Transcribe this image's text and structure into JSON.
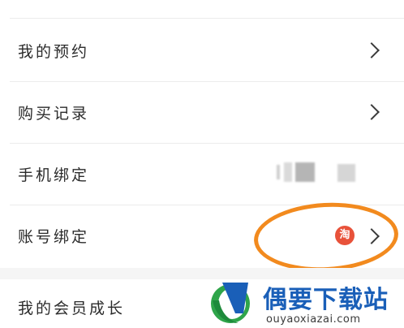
{
  "menu": {
    "items": [
      {
        "label": "我的预约",
        "has_arrow": true
      },
      {
        "label": "购买记录",
        "has_arrow": true
      },
      {
        "label": "手机绑定",
        "has_arrow": false,
        "value": "(blurred)"
      },
      {
        "label": "账号绑定",
        "has_arrow": true,
        "badge_text": "淘",
        "badge_color": "#e8523a"
      }
    ]
  },
  "section2": {
    "label": "我的会员成长"
  },
  "highlight": {
    "color": "#f28a1e",
    "target": "账号绑定"
  },
  "watermark": {
    "title": "偶要下载站",
    "url": "ouyaoxiazai.com",
    "logo_icon": "ouyao-logo-icon",
    "title_color": "#1a5fb8"
  }
}
